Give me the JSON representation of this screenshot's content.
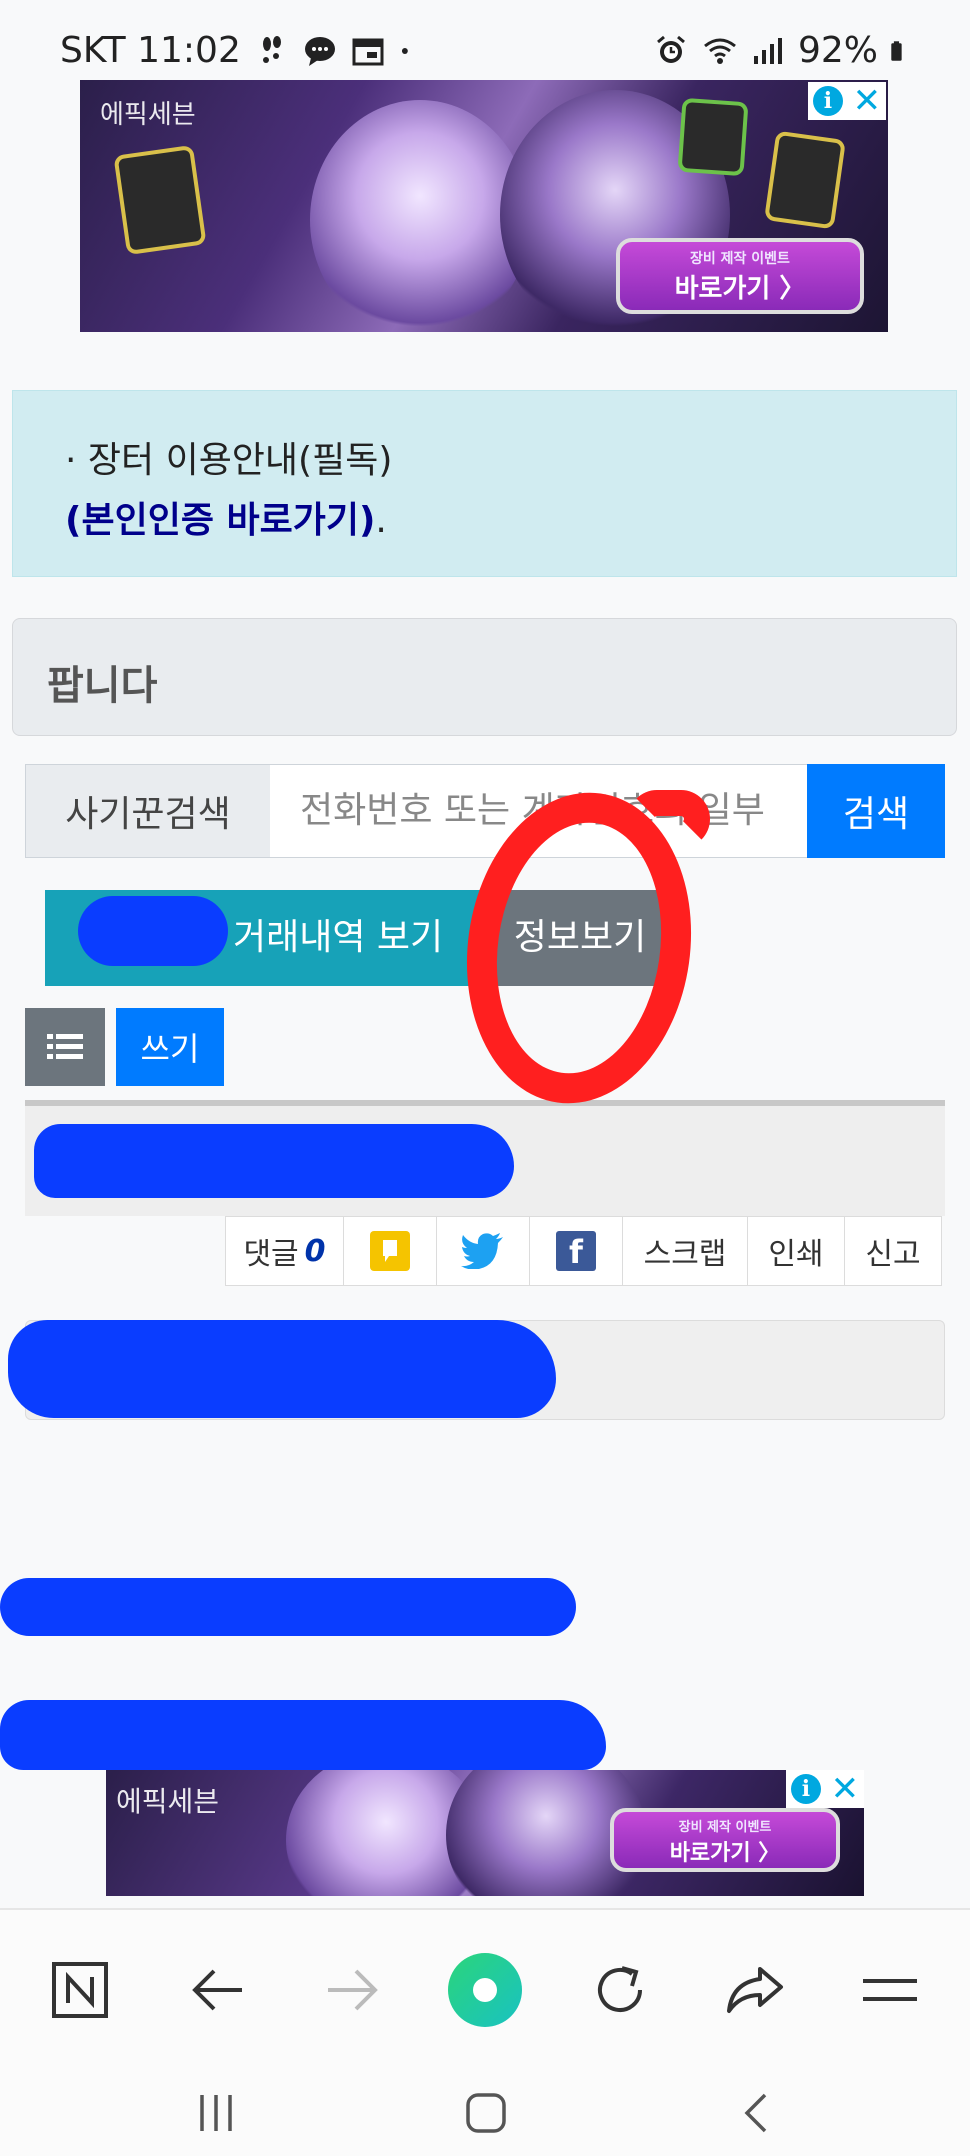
{
  "status_bar": {
    "carrier_time": "SKT 11:02",
    "battery": "92%",
    "icons": [
      "walk-icon",
      "chat-icon",
      "calendar-icon",
      "dot-icon",
      "alarm-icon",
      "wifi-icon",
      "signal-icon",
      "battery-icon"
    ]
  },
  "ads": {
    "top": {
      "brand": "에픽세븐",
      "cta_small": "장비 제작 이벤트",
      "cta_big": "바로가기 〉"
    },
    "bottom": {
      "brand": "에픽세븐",
      "cta_small": "장비 제작 이벤트",
      "cta_big": "바로가기 〉"
    },
    "info_glyph": "i",
    "close_glyph": "✕"
  },
  "notice": {
    "line1": "· 장터 이용안내(필독)",
    "line2": "(본인인증 바로가기)",
    "line2_suffix": "."
  },
  "board": {
    "title": "팝니다"
  },
  "search": {
    "label": "사기꾼검색",
    "placeholder": "전화번호 또는 계좌번호의 일부",
    "button": "검색"
  },
  "actions": {
    "history": "거래내역 보기",
    "info": "정보보기",
    "write": "쓰기"
  },
  "post_tools": {
    "comments_label": "댓글",
    "comments_count": "0",
    "scrap": "스크랩",
    "print": "인쇄",
    "report": "신고"
  },
  "colors": {
    "primary": "#007bff",
    "info": "#17a2b8",
    "secondary": "#6c757d",
    "notice_bg": "#d1ecf1",
    "redaction": "#0a3dff",
    "annotation": "#ff1f1f"
  },
  "browser_nav": [
    "naver-icon",
    "back-arrow-icon",
    "forward-arrow-icon",
    "green-home-icon",
    "refresh-icon",
    "share-icon",
    "menu-icon"
  ],
  "system_nav": [
    "recent-apps-icon",
    "home-icon",
    "back-icon"
  ]
}
